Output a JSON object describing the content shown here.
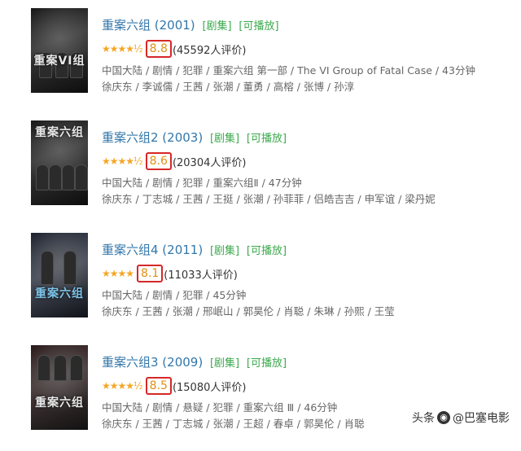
{
  "entries": [
    {
      "title": "重案六组 (2001)",
      "tag_series": "[剧集]",
      "tag_playable": "[可播放]",
      "stars": "★★★★½",
      "score": "8.8",
      "votes": "(45592人评价)",
      "info": "中国大陆 / 剧情 / 犯罪 / 重案六组 第一部 / The VI Group of Fatal Case / 43分钟",
      "cast": "徐庆东 / 李诚儒 / 王茜 / 张潮 / 董勇 / 高榕 / 张博 / 孙淳",
      "poster_text": "重案VI组"
    },
    {
      "title": "重案六组2 (2003)",
      "tag_series": "[剧集]",
      "tag_playable": "[可播放]",
      "stars": "★★★★½",
      "score": "8.6",
      "votes": "(20304人评价)",
      "info": "中国大陆 / 剧情 / 犯罪 / 重案六组Ⅱ / 47分钟",
      "cast": "徐庆东 / 丁志城 / 王茜 / 王挺 / 张潮 / 孙菲菲 / 侣皓吉吉 / 申军谊 / 梁丹妮",
      "poster_text": "重案六组"
    },
    {
      "title": "重案六组4 (2011)",
      "tag_series": "[剧集]",
      "tag_playable": "[可播放]",
      "stars": "★★★★",
      "score": "8.1",
      "votes": "(11033人评价)",
      "info": "中国大陆 / 剧情 / 犯罪 / 45分钟",
      "cast": "徐庆东 / 王茜 / 张潮 / 邢岷山 / 郭昊伦 / 肖聪 / 朱琳 / 孙熙 / 王莹",
      "poster_text": "重案六组"
    },
    {
      "title": "重案六组3 (2009)",
      "tag_series": "[剧集]",
      "tag_playable": "[可播放]",
      "stars": "★★★★½",
      "score": "8.5",
      "votes": "(15080人评价)",
      "info": "中国大陆 / 剧情 / 悬疑 / 犯罪 / 重案六组 Ⅲ / 46分钟",
      "cast": "徐庆东 / 王茜 / 丁志城 / 张潮 / 王超 / 春卓 / 郭昊伦 / 肖聪",
      "poster_text": "重案六组"
    }
  ],
  "watermark": {
    "prefix": "头条",
    "handle": "@巴塞电影",
    "logo_icon": "headline-logo-icon"
  },
  "colors": {
    "link": "#3377aa",
    "tag": "#3ba94d",
    "star": "#f5a623",
    "score": "#e09015",
    "highlight_box": "#d62828"
  }
}
